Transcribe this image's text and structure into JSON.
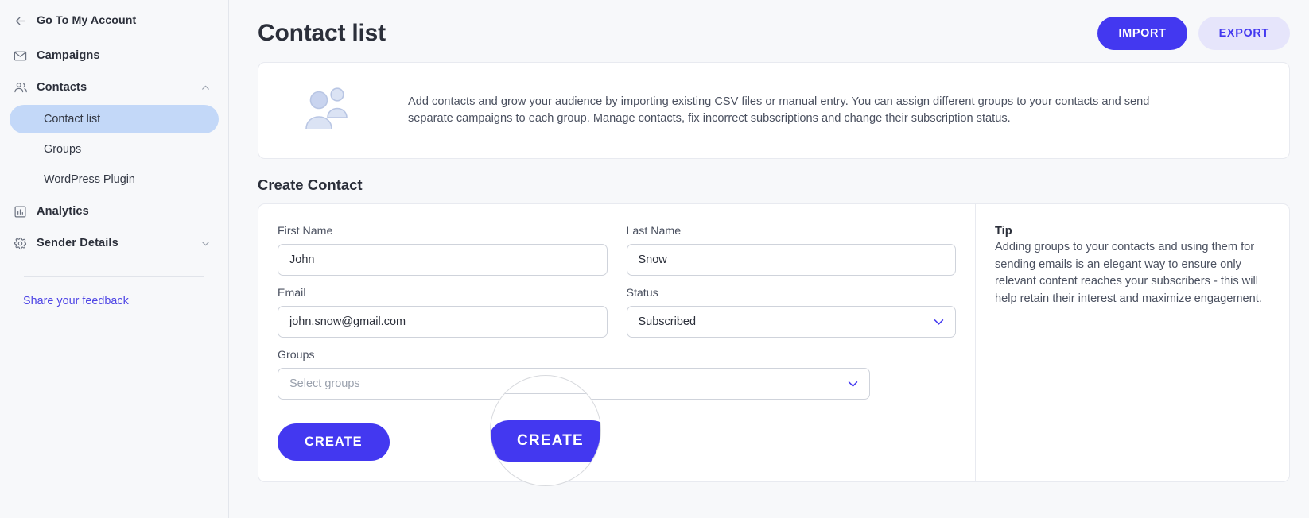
{
  "sidebar": {
    "back": {
      "label": "Go To My Account",
      "icon": "arrow-left-icon"
    },
    "items": [
      {
        "label": "Campaigns",
        "icon": "envelope-icon",
        "expandable": false
      },
      {
        "label": "Contacts",
        "icon": "people-icon",
        "expandable": true,
        "chevron": "chevron-up-icon"
      },
      {
        "label": "Analytics",
        "icon": "bar-chart-icon",
        "expandable": false
      },
      {
        "label": "Sender Details",
        "icon": "gear-icon",
        "expandable": true,
        "chevron": "chevron-down-icon"
      }
    ],
    "contacts_sub": [
      {
        "label": "Contact list",
        "active": true
      },
      {
        "label": "Groups",
        "active": false
      },
      {
        "label": "WordPress Plugin",
        "active": false
      }
    ],
    "feedback_label": "Share your feedback"
  },
  "header": {
    "title": "Contact list",
    "import_label": "IMPORT",
    "export_label": "EXPORT"
  },
  "banner": {
    "icon": "two-people-icon",
    "text": "Add contacts and grow your audience by importing existing CSV files or manual entry. You can assign different groups to your contacts and send separate campaigns to each group. Manage contacts, fix incorrect subscriptions and change their subscription status."
  },
  "form": {
    "section_title": "Create Contact",
    "first_name": {
      "label": "First Name",
      "value": "John",
      "placeholder": "First Name"
    },
    "last_name": {
      "label": "Last Name",
      "value": "Snow",
      "placeholder": "Last Name"
    },
    "email": {
      "label": "Email",
      "value": "john.snow@gmail.com",
      "placeholder": "Email"
    },
    "status": {
      "label": "Status",
      "value": "Subscribed",
      "chevron": "chevron-down-icon"
    },
    "groups": {
      "label": "Groups",
      "value": "",
      "placeholder": "Select groups",
      "chevron": "chevron-down-icon"
    },
    "create_label": "CREATE"
  },
  "tip": {
    "title": "Tip",
    "body": "Adding groups to your contacts and using them for sending emails is an elegant way to ensure only relevant content reaches your subscribers - this will help retain their interest and maximize engagement."
  },
  "lens": {
    "magnified_label": "CREATE"
  },
  "colors": {
    "accent": "#4338f0",
    "accent_soft": "#e6e5fb",
    "active_nav": "#c3d8f8",
    "page_bg": "#f7f8fa",
    "card_bg": "#ffffff",
    "border": "#e8eaf0"
  }
}
